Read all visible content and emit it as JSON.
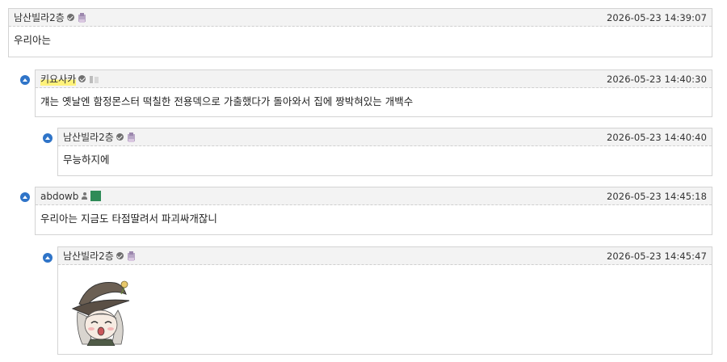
{
  "comments": [
    {
      "author": "남산빌라2층",
      "date": "2026-05-23 14:39:07",
      "text": "우리아는"
    },
    {
      "author": "키요사카",
      "date": "2026-05-23 14:40:30",
      "text": "걔는 옛날엔 함정몬스터 떡칠한 전용덱으로 가출했다가 돌아와서 집에 짱박혀있는 개백수"
    },
    {
      "author": "남산빌라2층",
      "date": "2026-05-23 14:40:40",
      "text": "무능하지에"
    },
    {
      "author": "abdowb",
      "date": "2026-05-23 14:45:18",
      "text": "우리아는 지금도 타점딸려서 파괴싸개잖니"
    },
    {
      "author": "남산빌라2층",
      "date": "2026-05-23 14:45:47",
      "text": ""
    }
  ],
  "icons": {
    "reply": "reply-arrow-icon",
    "verified": "check-badge-icon",
    "gallcon": "gallcon-icon",
    "member": "person-icon"
  },
  "colors": {
    "accent": "#2f74c8",
    "header_bg": "#f3f3f3",
    "border": "#d3d3d3",
    "highlight": "#fff27a"
  }
}
